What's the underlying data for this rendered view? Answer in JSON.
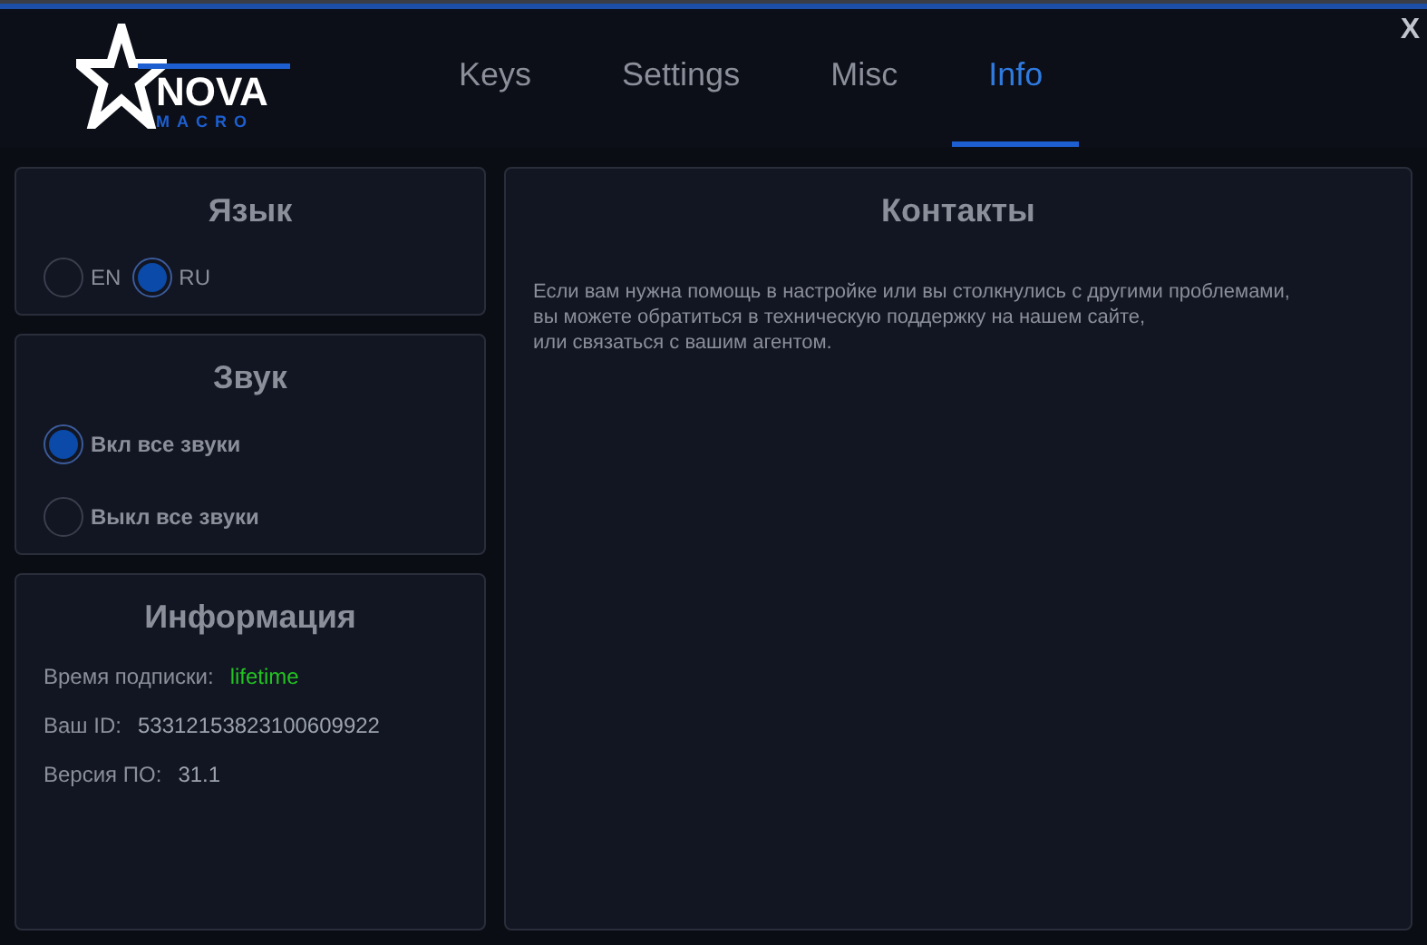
{
  "logo": {
    "title": "NOVA",
    "subtitle": "MACRO"
  },
  "tabs": [
    {
      "label": "Keys",
      "selected": false
    },
    {
      "label": "Settings",
      "selected": false
    },
    {
      "label": "Misc",
      "selected": false
    },
    {
      "label": "Info",
      "selected": true
    }
  ],
  "close": "X",
  "language": {
    "title": "Язык",
    "options": [
      {
        "label": "EN",
        "selected": false
      },
      {
        "label": "RU",
        "selected": true
      }
    ]
  },
  "sound": {
    "title": "Звук",
    "options": [
      {
        "label": "Вкл все звуки",
        "selected": true
      },
      {
        "label": "Выкл все звуки",
        "selected": false
      }
    ]
  },
  "info": {
    "title": "Информация",
    "rows": [
      {
        "label": "Время подписки:",
        "value": "lifetime",
        "color": "#22c322"
      },
      {
        "label": "Ваш ID:",
        "value": "53312153823100609922",
        "color": "#9ca3af"
      },
      {
        "label": "Версия ПО:",
        "value": "31.1",
        "color": "#9ca3af"
      }
    ]
  },
  "contacts": {
    "title": "Контакты",
    "lines": [
      "Если вам нужна помощь в настройке или вы столкнулись с другими проблемами,",
      "вы можете обратиться в техническую поддержку на нашем сайте,",
      "или связаться с вашим агентом."
    ]
  }
}
